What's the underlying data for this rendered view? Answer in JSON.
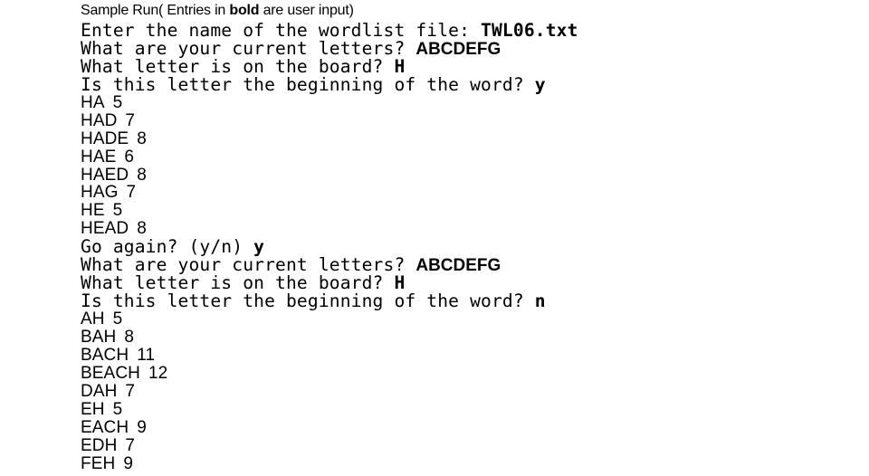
{
  "header": {
    "prefix": "Sample Run( Entries in ",
    "bold_word": "bold",
    "suffix": " are user input)"
  },
  "session": [
    {
      "prompts": {
        "filename": {
          "prompt": "Enter the name of the wordlist file: ",
          "input": "TWL06.txt"
        },
        "letters": {
          "prompt": "What are your current letters? ",
          "input": "ABCDEFG"
        },
        "board": {
          "prompt": "What letter is on the board? ",
          "input": "H"
        },
        "beginning": {
          "prompt": "Is this letter the beginning of the word? ",
          "input": "y"
        }
      },
      "results": [
        {
          "word": "HA",
          "score": "5"
        },
        {
          "word": "HAD",
          "score": "7"
        },
        {
          "word": "HADE",
          "score": "8"
        },
        {
          "word": "HAE",
          "score": "6"
        },
        {
          "word": "HAED",
          "score": "8"
        },
        {
          "word": "HAG",
          "score": "7"
        },
        {
          "word": "HE",
          "score": "5"
        },
        {
          "word": "HEAD",
          "score": "8"
        }
      ],
      "again": {
        "prompt": "Go again? (y/n) ",
        "input": "y"
      }
    },
    {
      "prompts": {
        "letters": {
          "prompt": "What are your current letters? ",
          "input": "ABCDEFG"
        },
        "board": {
          "prompt": "What letter is on the board? ",
          "input": "H"
        },
        "beginning": {
          "prompt": "Is this letter the beginning of the word? ",
          "input": "n"
        }
      },
      "results": [
        {
          "word": "AH",
          "score": "5"
        },
        {
          "word": "BAH",
          "score": "8"
        },
        {
          "word": "BACH",
          "score": "11"
        },
        {
          "word": "BEACH",
          "score": "12"
        },
        {
          "word": "DAH",
          "score": "7"
        },
        {
          "word": "EH",
          "score": "5"
        },
        {
          "word": "EACH",
          "score": "9"
        },
        {
          "word": "EDH",
          "score": "7"
        },
        {
          "word": "FEH",
          "score": "9"
        }
      ]
    }
  ]
}
